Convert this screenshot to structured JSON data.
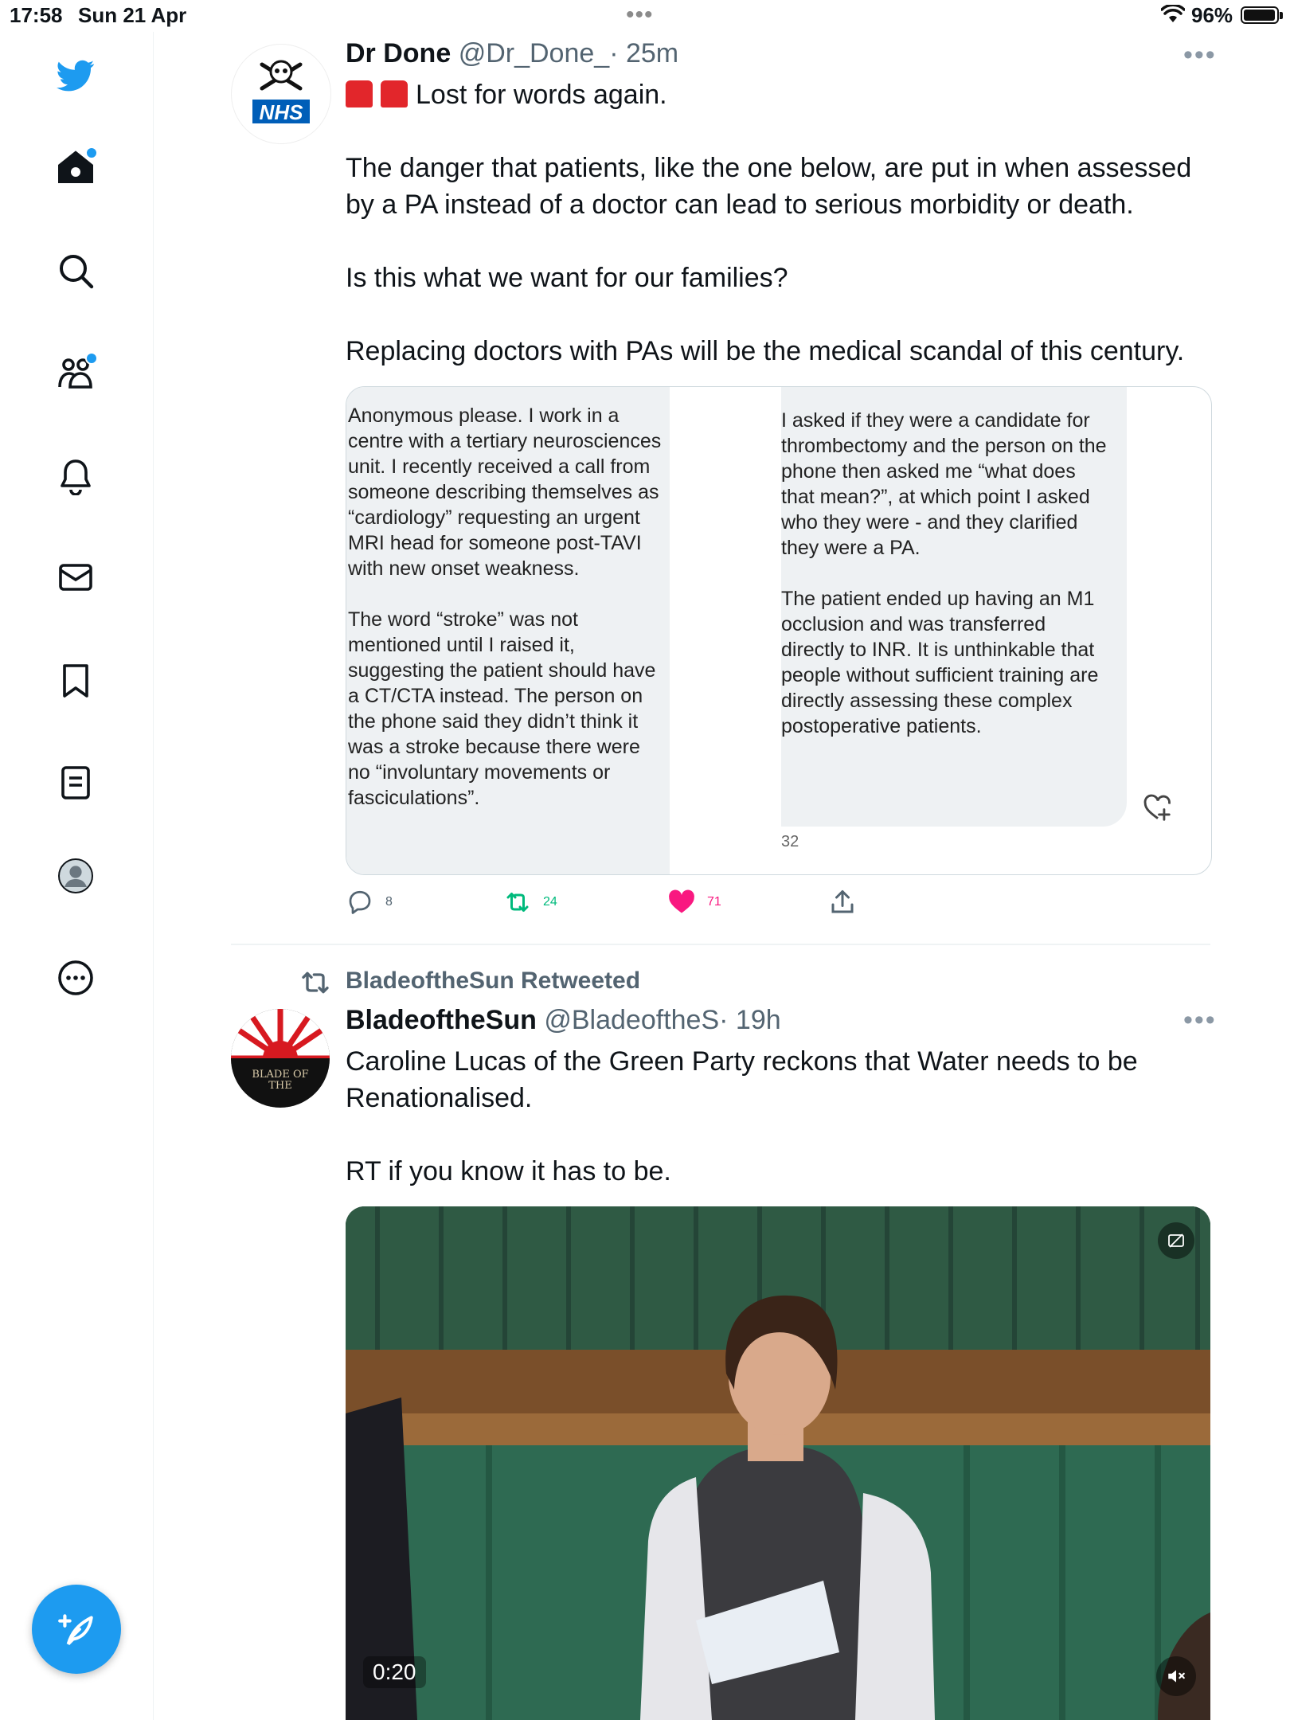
{
  "status_bar": {
    "time": "17:58",
    "date": "Sun 21 Apr",
    "battery_pct": "96%"
  },
  "sidebar": {
    "items": [
      {
        "name": "twitter-logo",
        "icon": "bird"
      },
      {
        "name": "home",
        "icon": "home",
        "has_dot": true
      },
      {
        "name": "search",
        "icon": "magnifier"
      },
      {
        "name": "communities",
        "icon": "people",
        "has_dot": true
      },
      {
        "name": "notifications",
        "icon": "bell"
      },
      {
        "name": "messages",
        "icon": "envelope"
      },
      {
        "name": "bookmarks",
        "icon": "bookmark"
      },
      {
        "name": "lists",
        "icon": "list"
      },
      {
        "name": "profile",
        "icon": "avatar"
      },
      {
        "name": "more",
        "icon": "ellipsis-circle"
      }
    ],
    "compose_icon": "feather-plus"
  },
  "tweets": [
    {
      "author_name": "Dr Done",
      "handle": "@Dr_Done_",
      "time": "· 25m",
      "avatar_text": "NHS",
      "text_first": "Lost for words again.",
      "text_lines": [
        "The danger that patients, like the one below, are put in when assessed by a PA instead of a doctor can lead to serious morbidity or death.",
        "",
        "Is this what we want for our families?",
        "",
        "Replacing doctors with PAs will be the medical scandal of this century."
      ],
      "image_left_paragraphs": [
        "Anonymous please. I work in a centre with a tertiary neurosciences unit. I recently received a call from someone describing themselves as “cardiology” requesting an urgent MRI head for someone post-TAVI with new onset weakness.",
        "The word “stroke” was not mentioned until I raised it, suggesting the patient should have a CT/CTA instead. The person on the phone said they didn’t think it was a stroke because there were no “involuntary movements or fasciculations”."
      ],
      "image_right_paragraphs": [
        "I asked if they were a candidate for thrombectomy and the person on the phone then asked me “what does that mean?”, at which point I asked who they were - and they clarified they were a PA.",
        "The patient ended up having an M1 occlusion and was transferred directly to INR. It is unthinkable that people without sufficient training are directly assessing these complex postoperative patients."
      ],
      "image_right_footnote": "32",
      "replies": "8",
      "retweets": "24",
      "likes": "71"
    },
    {
      "retweeted_by": "BladeoftheSun Retweeted",
      "author_name": "BladeoftheSun",
      "handle": "@BladeoftheS",
      "time": "· 19h",
      "avatar_text": "BLADE OF THE",
      "text_lines": [
        "Caroline Lucas of the Green Party reckons that Water needs to be Renationalised.",
        "",
        "RT if you know it has to be."
      ],
      "video_time": "0:20"
    }
  ],
  "colors": {
    "accent": "#1d9bf0",
    "retweet": "#00ba7c",
    "like": "#f91880",
    "secondary_text": "#536471"
  }
}
